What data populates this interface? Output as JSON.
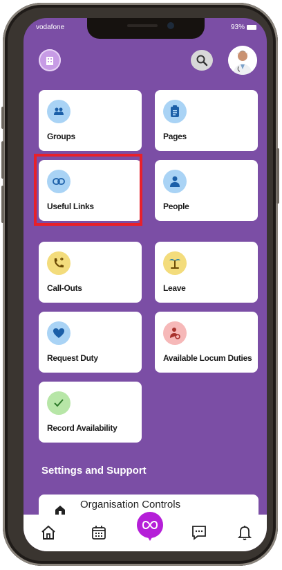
{
  "status_bar": {
    "carrier": "vodafone",
    "battery": "93%"
  },
  "header": {
    "logo_icon": "building-icon",
    "search_icon": "search-icon",
    "avatar_icon": "doctor-avatar"
  },
  "tiles": [
    {
      "label": "Groups",
      "icon": "groups-icon",
      "color": "#a9d3f5"
    },
    {
      "label": "Pages",
      "icon": "clipboard-icon",
      "color": "#a9d3f5"
    },
    {
      "label": "Useful Links",
      "icon": "link-icon",
      "color": "#a9d3f5"
    },
    {
      "label": "People",
      "icon": "person-icon",
      "color": "#a9d3f5"
    },
    {
      "label": "Call-Outs",
      "icon": "phone-forward-icon",
      "color": "#f3dc7c"
    },
    {
      "label": "Leave",
      "icon": "palm-tree-icon",
      "color": "#f3dc7c"
    },
    {
      "label": "Request Duty",
      "icon": "heart-icon",
      "color": "#a9d3f5"
    },
    {
      "label": "Available Locum Duties",
      "icon": "locum-person-icon",
      "color": "#f6b8b8"
    },
    {
      "label": "Record Availability",
      "icon": "check-icon",
      "color": "#b7e6a7"
    }
  ],
  "settings": {
    "title": "Settings and Support",
    "org_controls_label": "Organisation Controls"
  },
  "bottom_nav": {
    "items": [
      "home-icon",
      "calendar-icon",
      "infinity-icon",
      "chat-icon",
      "bell-icon"
    ]
  },
  "colors": {
    "background": "#7b4ea5",
    "highlight": "#e8202a",
    "center_nav": "#b51fd8"
  }
}
